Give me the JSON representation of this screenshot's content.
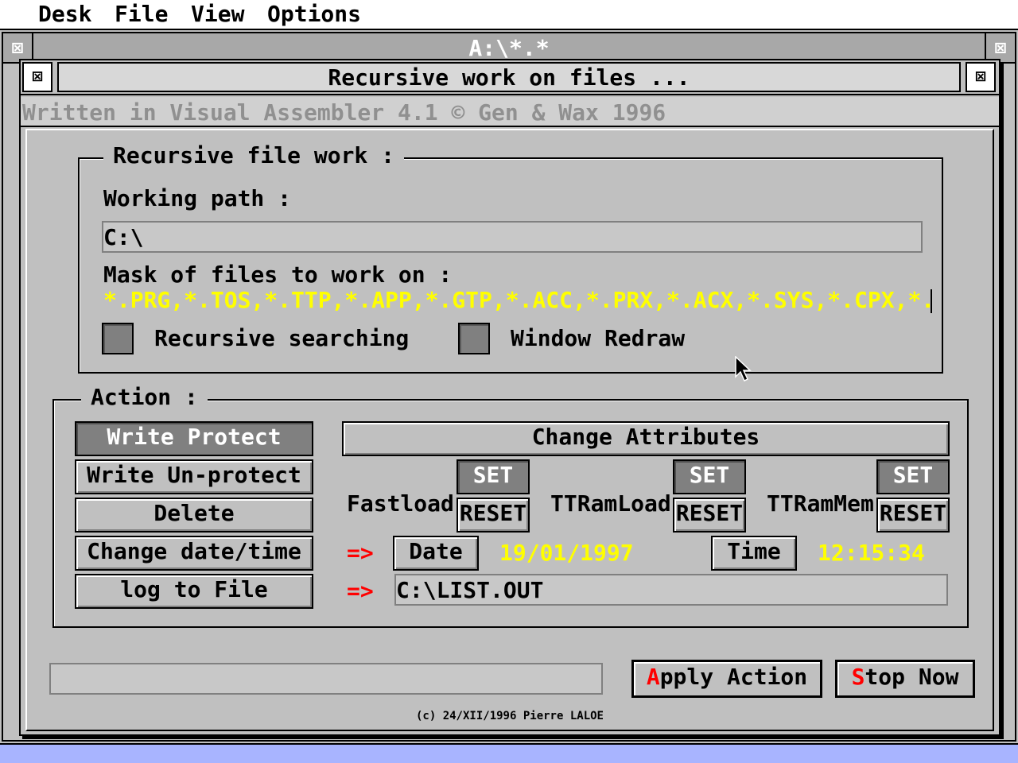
{
  "menubar": {
    "items": [
      "Desk",
      "File",
      "View",
      "Options"
    ]
  },
  "bg_window": {
    "title": "A:\\*.*"
  },
  "dialog": {
    "title": "Recursive work on files ...",
    "info": "Written in Visual Assembler 4.1 © Gen & Wax 1996",
    "recursive_group": {
      "title": "Recursive file work :",
      "working_path_label": "Working path :",
      "working_path_value": "C:\\",
      "mask_label": "Mask of files to work on :",
      "mask_value": "*.PRG,*.TOS,*.TTP,*.APP,*.GTP,*.ACC,*.PRX,*.ACX,*.SYS,*.CPX,*.CPZ",
      "recursive_searching_label": "Recursive searching",
      "recursive_searching_checked": false,
      "window_redraw_label": "Window Redraw",
      "window_redraw_checked": false
    },
    "action_group": {
      "title": "Action :",
      "buttons": [
        "Write Protect",
        "Write Un-protect",
        "Delete",
        "Change date/time",
        "log to File"
      ],
      "selected_button": "Write Protect",
      "change_attributes_label": "Change Attributes",
      "attributes": [
        {
          "label": "Fastload",
          "set": "SET",
          "reset": "RESET"
        },
        {
          "label": "TTRamLoad",
          "set": "SET",
          "reset": "RESET"
        },
        {
          "label": "TTRamMem",
          "set": "SET",
          "reset": "RESET"
        }
      ],
      "arrow": "=>",
      "date_button": "Date",
      "date_value": "19/01/1997",
      "time_button": "Time",
      "time_value": "12:15:34",
      "log_file_value": "C:\\LIST.OUT"
    },
    "apply_button": {
      "hotkey": "A",
      "rest": "pply Action"
    },
    "stop_button": {
      "hotkey": "S",
      "rest": "top Now"
    },
    "copyright": "(c) 24/XII/1996 Pierre LALOE"
  },
  "colors": {
    "accent_yellow": "#ffff00",
    "hotkey_red": "#ff0000",
    "selected_gray": "#808080",
    "desktop": "#a8b4ff"
  },
  "icons": {
    "window_closer": "close-icon",
    "mouse_pointer": "arrow-cursor-icon"
  }
}
